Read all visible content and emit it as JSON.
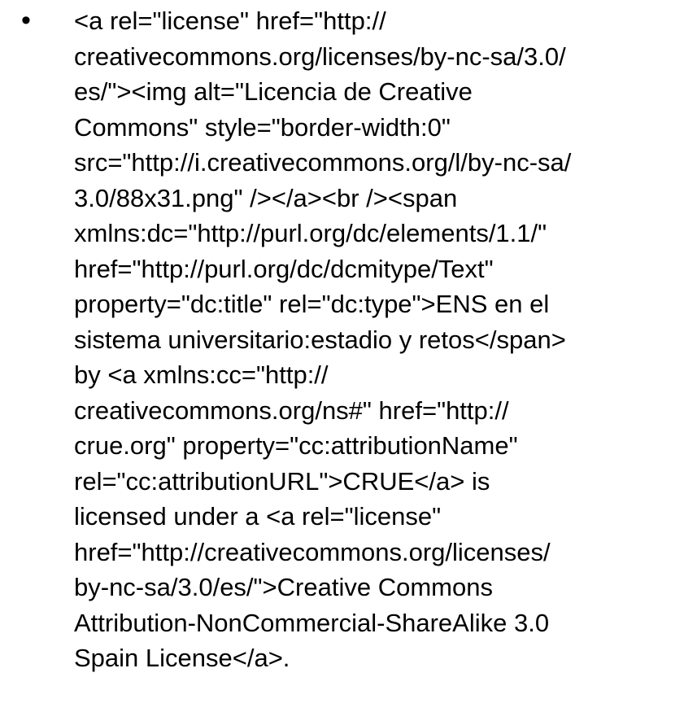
{
  "slide": {
    "bullet_char": "•",
    "lines": [
      "<a rel=\"license\" href=\"http://",
      "creativecommons.org/licenses/by-nc-sa/3.0/",
      "es/\"><img alt=\"Licencia de Creative",
      "Commons\" style=\"border-width:0\"",
      "src=\"http://i.creativecommons.org/l/by-nc-sa/",
      "3.0/88x31.png\" /></a><br /><span",
      "xmlns:dc=\"http://purl.org/dc/elements/1.1/\"",
      "href=\"http://purl.org/dc/dcmitype/Text\"",
      "property=\"dc:title\" rel=\"dc:type\">ENS en el",
      "sistema universitario:estadio y retos</span>",
      "by <a xmlns:cc=\"http://",
      "creativecommons.org/ns#\" href=\"http://",
      "crue.org\" property=\"cc:attributionName\"",
      "rel=\"cc:attributionURL\">CRUE</a> is",
      "licensed under a <a rel=\"license\"",
      "href=\"http://creativecommons.org/licenses/",
      "by-nc-sa/3.0/es/\">Creative Commons",
      "Attribution-NonCommercial-ShareAlike 3.0",
      "Spain License</a>."
    ]
  }
}
